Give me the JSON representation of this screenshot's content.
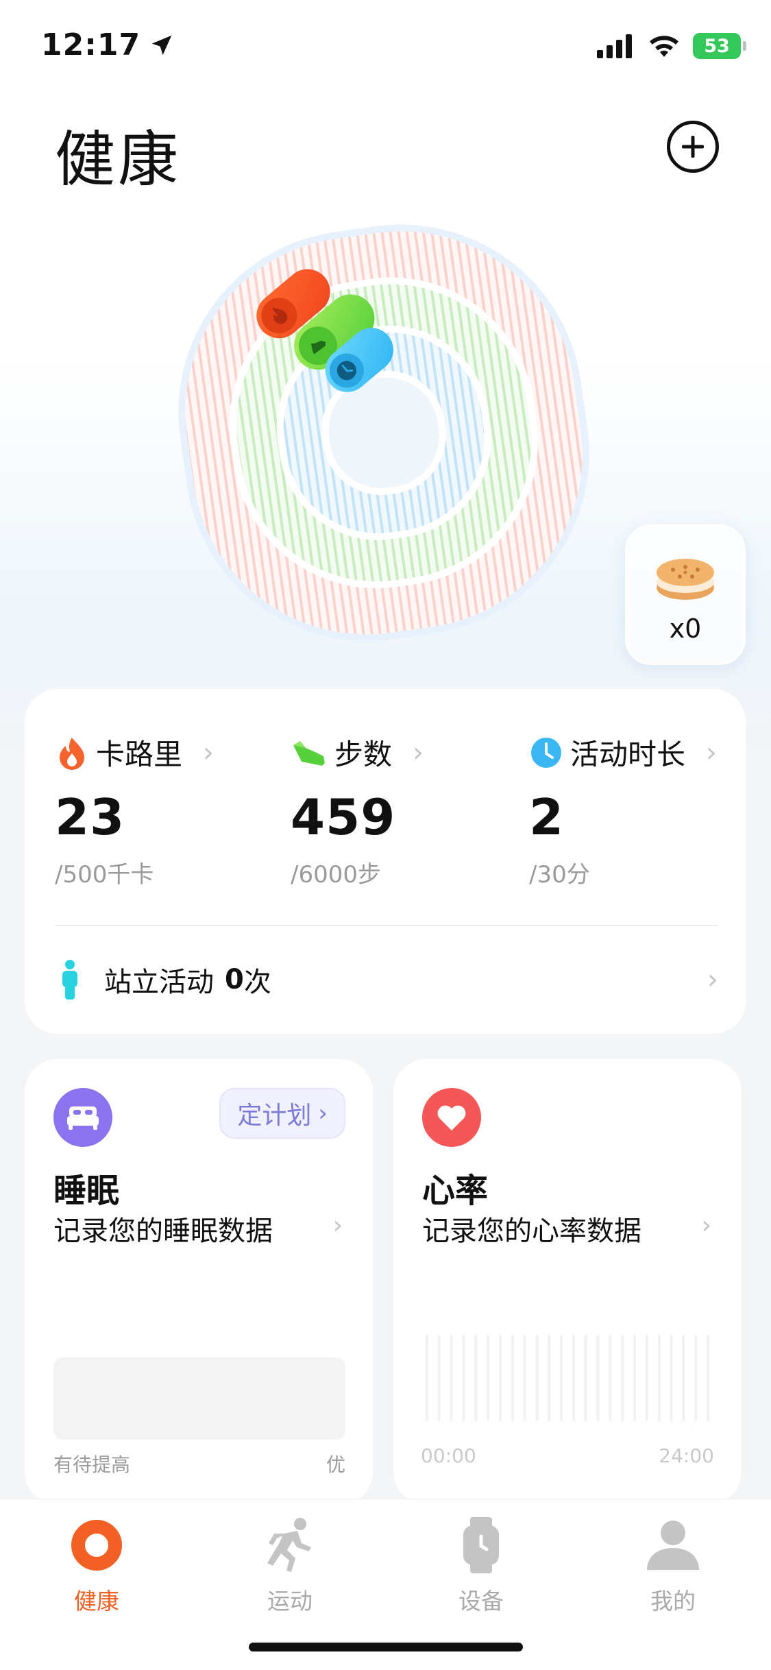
{
  "status_bar": {
    "time": "12:17",
    "battery": "53"
  },
  "header": {
    "title": "健康"
  },
  "cookie": {
    "count": "x0"
  },
  "metrics": [
    {
      "label": "卡路里",
      "value": "23",
      "goal": "/500千卡",
      "color": "#f8622c"
    },
    {
      "label": "步数",
      "value": "459",
      "goal": "/6000步",
      "color": "#57d13b"
    },
    {
      "label": "活动时长",
      "value": "2",
      "goal": "/30分",
      "color": "#3ab7f3"
    }
  ],
  "stand": {
    "label": "站立活动",
    "count": "0",
    "unit": "次"
  },
  "sleep_card": {
    "plan_label": "定计划",
    "title": "睡眠",
    "desc": "记录您的睡眠数据",
    "scale_low": "有待提高",
    "scale_high": "优"
  },
  "heart_card": {
    "title": "心率",
    "desc": "记录您的心率数据",
    "time_start": "00:00",
    "time_end": "24:00"
  },
  "tabs": [
    {
      "label": "健康",
      "icon": "ring-icon",
      "active": true
    },
    {
      "label": "运动",
      "icon": "runner-icon",
      "active": false
    },
    {
      "label": "设备",
      "icon": "watch-icon",
      "active": false
    },
    {
      "label": "我的",
      "icon": "person-icon",
      "active": false
    }
  ],
  "colors": {
    "accent": "#f26024",
    "sleep": "#8b73f0",
    "heart": "#f55656",
    "stand": "#27d3e0"
  }
}
